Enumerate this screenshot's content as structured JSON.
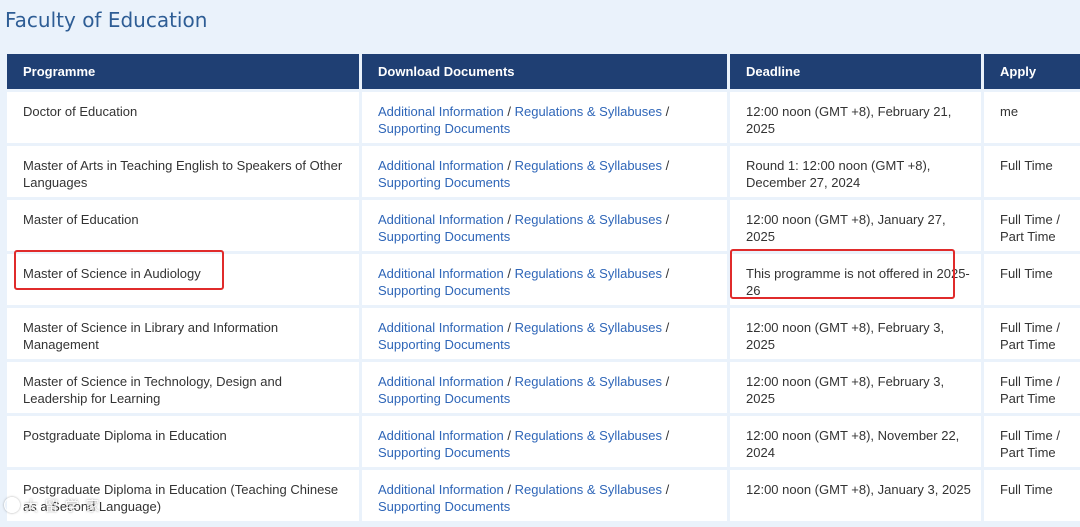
{
  "page": {
    "title": "Faculty of Education"
  },
  "table": {
    "headers": {
      "programme": "Programme",
      "documents": "Download Documents",
      "deadline": "Deadline",
      "apply": "Apply"
    },
    "link_labels": {
      "additional": "Additional Information",
      "regulations": "Regulations & Syllabuses",
      "supporting": "Supporting Documents",
      "separator": " / "
    },
    "rows": [
      {
        "programme": "Doctor of Education",
        "deadline": "12:00 noon (GMT +8), February 21, 2025",
        "apply": "me"
      },
      {
        "programme": "Master of Arts in Teaching English to Speakers of Other Languages",
        "deadline": "Round 1: 12:00 noon (GMT +8), December 27, 2024",
        "apply": "Full Time"
      },
      {
        "programme": "Master of Education",
        "deadline": "12:00 noon (GMT +8), January 27, 2025",
        "apply": "Full Time / Part Time"
      },
      {
        "programme": "Master of Science in Audiology",
        "deadline": "This programme is not offered in 2025-26",
        "apply": "Full Time"
      },
      {
        "programme": "Master of Science in Library and Information Management",
        "deadline": "12:00 noon (GMT +8), February 3, 2025",
        "apply": "Full Time / Part Time"
      },
      {
        "programme": "Master of Science in Technology, Design and Leadership for Learning",
        "deadline": "12:00 noon (GMT +8), February 3, 2025",
        "apply": "Full Time / Part Time"
      },
      {
        "programme": "Postgraduate Diploma in Education",
        "deadline": "12:00 noon (GMT +8), November 22, 2024",
        "apply": "Full Time / Part Time"
      },
      {
        "programme": "Postgraduate Diploma in Education (Teaching Chinese as a Second Language)",
        "deadline": "12:00 noon (GMT +8), January 3, 2025",
        "apply": "Full Time"
      }
    ]
  },
  "watermark": {
    "text": "大 留 学 家"
  },
  "colors": {
    "header_bg": "#1f3f73",
    "link": "#2f66b8",
    "highlight": "#e02b2b",
    "page_bg": "#eaf2fb"
  }
}
